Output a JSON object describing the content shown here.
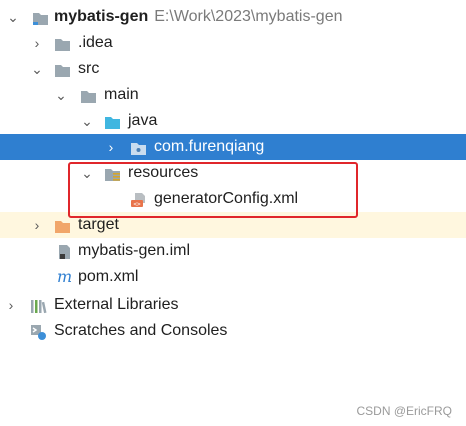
{
  "tree": {
    "root": {
      "name": "mybatis-gen",
      "path": "E:\\Work\\2023\\mybatis-gen",
      "icon": "project-folder-icon",
      "state": "expanded"
    },
    "idea": {
      "name": ".idea",
      "icon": "folder-icon",
      "state": "collapsed"
    },
    "src": {
      "name": "src",
      "icon": "folder-icon",
      "state": "expanded"
    },
    "main": {
      "name": "main",
      "icon": "folder-icon",
      "state": "expanded"
    },
    "java": {
      "name": "java",
      "icon": "source-root-folder-icon",
      "state": "expanded"
    },
    "package": {
      "name": "com.furenqiang",
      "icon": "package-icon",
      "state": "collapsed",
      "selected": true
    },
    "resources": {
      "name": "resources",
      "icon": "resources-root-folder-icon",
      "state": "expanded"
    },
    "generator_config": {
      "name": "generatorConfig.xml",
      "icon": "xml-file-icon"
    },
    "target": {
      "name": "target",
      "icon": "excluded-folder-icon",
      "state": "collapsed"
    },
    "iml": {
      "name": "mybatis-gen.iml",
      "icon": "iml-file-icon"
    },
    "pom": {
      "name": "pom.xml",
      "icon": "maven-pom-icon"
    },
    "external_libraries": {
      "name": "External Libraries",
      "icon": "libraries-icon",
      "state": "collapsed"
    },
    "scratches": {
      "name": "Scratches and Consoles",
      "icon": "scratches-icon"
    }
  },
  "colors": {
    "selection": "#2f7fd0",
    "highlight_border": "#e0262b",
    "excluded_bg": "#fff7df"
  },
  "watermark": "CSDN @EricFRQ"
}
